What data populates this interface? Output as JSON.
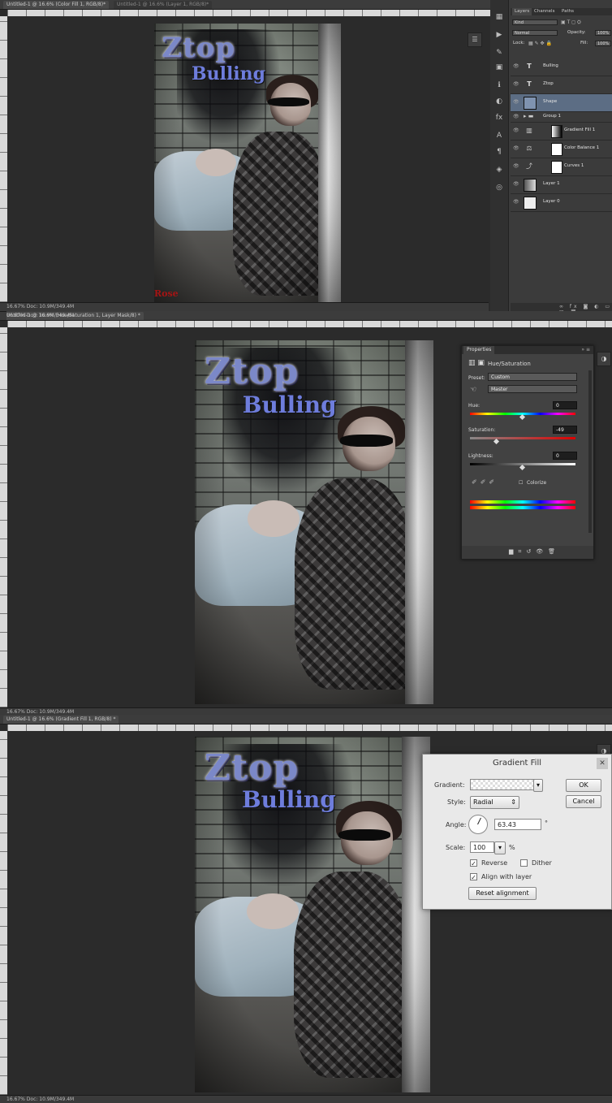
{
  "panel1": {
    "tabs": [
      "Untitled-1 @ 16.6% (Color Fill 1, RGB/8)*",
      "Untitled-1 @ 16.6% (Layer 1, RGB/8)*"
    ],
    "status": "16.67%    Doc: 10.9M/349.4M",
    "canvas": {
      "title1": "Ztop",
      "title2": "Bulling",
      "signature": "Rose"
    },
    "layers_panel": {
      "tabs": [
        "Layers",
        "Channels",
        "Paths"
      ],
      "kind": "Kind",
      "blend": "Normal",
      "opacity_label": "Opacity:",
      "opacity_value": "100%",
      "lock_label": "Lock:",
      "fill_label": "Fill:",
      "fill_value": "100%",
      "layers": [
        {
          "name": "Bulling",
          "type": "text"
        },
        {
          "name": "Ztop",
          "type": "text"
        },
        {
          "name": "Shape",
          "type": "shape"
        },
        {
          "name": "Group 1",
          "type": "group"
        },
        {
          "name": "Gradient Fill 1",
          "type": "adjust"
        },
        {
          "name": "Color Balance 1",
          "type": "adjust"
        },
        {
          "name": "Curves 1",
          "type": "adjust"
        },
        {
          "name": "Layer 1",
          "type": "image"
        },
        {
          "name": "Layer 0",
          "type": "image"
        }
      ]
    }
  },
  "panel2": {
    "status": "16.67%    Doc: 10.9M/349.4M",
    "tab": "Untitled-1 @ 16.6% (Hue/Saturation 1, Layer Mask/8) *",
    "canvas": {
      "title1": "Ztop",
      "title2": "Bulling"
    },
    "properties": {
      "tab": "Properties",
      "header": "Hue/Saturation",
      "preset_label": "Preset:",
      "preset_value": "Custom",
      "channel_value": "Master",
      "hue_label": "Hue:",
      "hue_value": "0",
      "saturation_label": "Saturation:",
      "saturation_value": "-49",
      "lightness_label": "Lightness:",
      "lightness_value": "0",
      "colorize_label": "Colorize"
    }
  },
  "panel3": {
    "status": "16.67%    1/8    Doc: 10.9M/349.4M",
    "tab": "Untitled-1 @ 16.6% (Gradient Fill 1, RGB/8) *",
    "bottom_status": "16.67%    Doc: 10.9M/349.4M",
    "canvas": {
      "title1": "Ztop",
      "title2": "Bulling"
    },
    "gradient_fill": {
      "title": "Gradient Fill",
      "gradient_label": "Gradient:",
      "style_label": "Style:",
      "style_value": "Radial",
      "angle_label": "Angle:",
      "angle_value": "63.43",
      "angle_unit": "°",
      "scale_label": "Scale:",
      "scale_value": "100",
      "scale_unit": "%",
      "reverse_label": "Reverse",
      "dither_label": "Dither",
      "align_label": "Align with layer",
      "reset_label": "Reset alignment",
      "ok_label": "OK",
      "cancel_label": "Cancel"
    }
  }
}
